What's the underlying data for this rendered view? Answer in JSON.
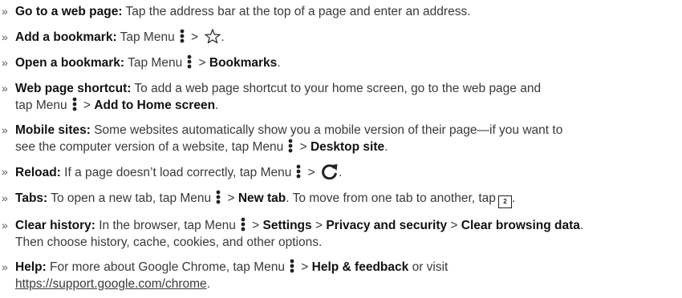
{
  "items": [
    {
      "head": "Go to a web page:",
      "t1": " Tap the address bar at the top of a page and enter an address."
    },
    {
      "head": "Add a bookmark:",
      "t1": " Tap Menu",
      "gt": " > ",
      "t2": "."
    },
    {
      "head": "Open a bookmark:",
      "t1": " Tap Menu",
      "gt": " > ",
      "b1": "Bookmarks",
      "t2": "."
    },
    {
      "head": "Web page shortcut:",
      "t1": " To add a web page shortcut to your home screen, go to the web page and",
      "t1b": "tap Menu",
      "gt": " > ",
      "b1": "Add to Home screen",
      "t2": "."
    },
    {
      "head": "Mobile sites:",
      "t1": " Some websites automatically show you a mobile version of their page—if you want to",
      "t1b": "see the computer version of a website, tap Menu",
      "gt": " > ",
      "b1": "Desktop site",
      "t2": "."
    },
    {
      "head": "Reload:",
      "t1": " If a page doesn’t load correctly, tap Menu",
      "gt": " > ",
      "t2": "."
    },
    {
      "head": "Tabs:",
      "t1": " To open a new tab, tap Menu",
      "gt": " > ",
      "b1": "New tab",
      "t2": ". To move from one tab to another, tap",
      "tab_count": "2",
      "t3": "."
    },
    {
      "head": "Clear history:",
      "t1": " In the browser, tap Menu",
      "gt": " > ",
      "b1": "Settings",
      "gt2": " > ",
      "b2": "Privacy and security",
      "gt3": " > ",
      "b3": "Clear browsing data",
      "t2": ".",
      "t3": "Then choose history, cache, cookies, and other options."
    },
    {
      "head": "Help:",
      "t1": " For more about Google Chrome, tap Menu",
      "gt": " > ",
      "b1": "Help & feedback",
      "t2": " or visit",
      "link": "https://support.google.com/chrome",
      "t3": "."
    }
  ],
  "bullet": "»"
}
